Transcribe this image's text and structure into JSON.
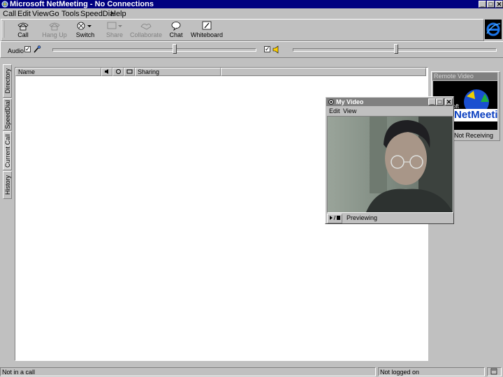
{
  "window": {
    "title": "Microsoft NetMeeting - No Connections",
    "controls": {
      "minimize": "_",
      "maximize": "□",
      "close": "✕"
    }
  },
  "menu": [
    "Call",
    "Edit",
    "View",
    "Go",
    "Tools",
    "SpeedDial",
    "Help"
  ],
  "toolbar": {
    "buttons": [
      {
        "label": "Call",
        "icon": "call-icon",
        "enabled": true
      },
      {
        "label": "Hang Up",
        "icon": "hang-up-icon",
        "enabled": false
      },
      {
        "label": "Switch",
        "icon": "switch-icon",
        "enabled": true
      },
      {
        "label": "Share",
        "icon": "share-icon",
        "enabled": false
      },
      {
        "label": "Collaborate",
        "icon": "collaborate-icon",
        "enabled": false
      },
      {
        "label": "Chat",
        "icon": "chat-icon",
        "enabled": true
      },
      {
        "label": "Whiteboard",
        "icon": "whiteboard-icon",
        "enabled": true
      }
    ]
  },
  "audio": {
    "label": "Audio",
    "mic_checked": true,
    "speaker_checked": true,
    "mic_level": 0.5,
    "speaker_level": 0.5
  },
  "side_tabs": [
    "Directory",
    "SpeedDial",
    "Current Call",
    "History"
  ],
  "list": {
    "columns": [
      "Name",
      "",
      "",
      "",
      "Sharing"
    ],
    "column_icons": [
      "",
      "audio-icon",
      "video-icon",
      "card-icon",
      ""
    ],
    "rows": []
  },
  "remote_video": {
    "title": "Remote Video",
    "logo_text": "NetMeeting",
    "logo_prefix": "oft",
    "status": "Not Receiving"
  },
  "my_video": {
    "title": "My Video",
    "menu": [
      "Edit",
      "View"
    ],
    "status": "Previewing"
  },
  "statusbar": {
    "call_status": "Not in a call",
    "login_status": "Not logged on"
  },
  "colors": {
    "titlebar": "#000080",
    "face": "#c0c0c0",
    "logo_blue": "#0a3fc0"
  }
}
